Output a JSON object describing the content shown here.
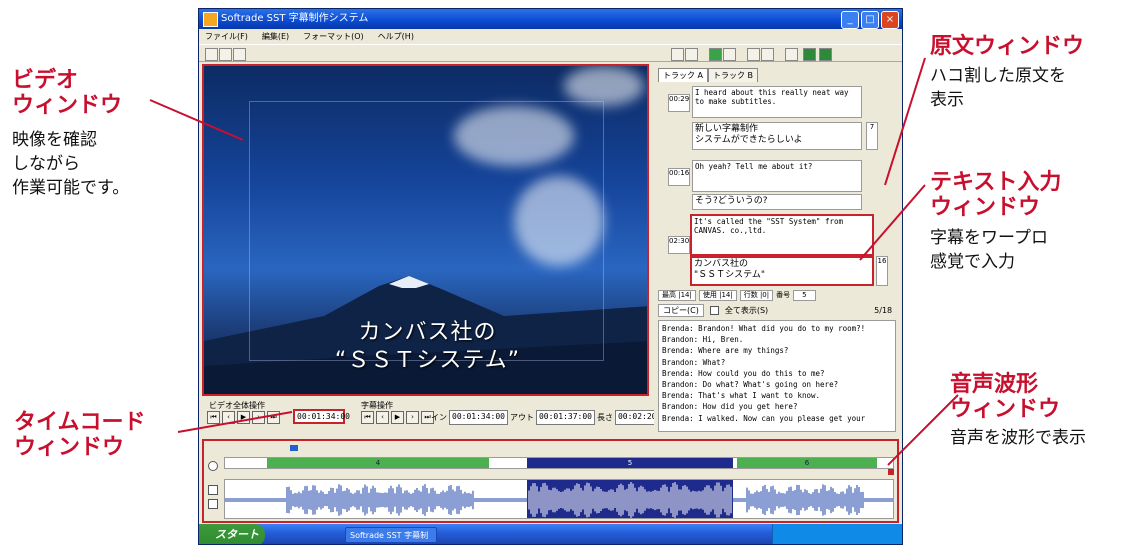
{
  "window": {
    "title": "Softrade SST 字幕制作システム",
    "menu": [
      "ファイル(F)",
      "編集(E)",
      "フォーマット(O)",
      "ヘルプ(H)"
    ],
    "min": "_",
    "max": "□",
    "close": "×"
  },
  "video": {
    "subtitle_line1": "カンバス社の",
    "subtitle_line2": "“ＳＳＴシステム”"
  },
  "video_controls": {
    "label": "ビデオ全体操作",
    "timecode": "00:01:34:00"
  },
  "subtitle_controls": {
    "label": "字幕操作",
    "in_label": "イン",
    "in_value": "00:01:34:00",
    "out_label": "アウト",
    "out_value": "00:01:37:00",
    "length_label": "長さ",
    "length_value": "00:02:20"
  },
  "tabs": [
    "トラック A",
    "トラック B"
  ],
  "entries": [
    {
      "index": "00:29",
      "source": "I heard about this really neat way to make subtitles.",
      "text": "新しい字幕制作\nシステムができたらしいよ",
      "flag": "7"
    },
    {
      "index": "00:16",
      "source": "Oh yeah? Tell me about it?",
      "text": "そう?どういうの?",
      "flag": ""
    },
    {
      "index": "02:30",
      "source": "It's called the \"SST System\" from CANVAS. co.,ltd.",
      "text": "カンバス社の\n\"ＳＳＴシステム\"",
      "flag": "16"
    }
  ],
  "stats": {
    "labels": [
      "最高 |14|",
      "使用 |14|",
      "行数 |0|",
      "番号"
    ],
    "count_value": "5"
  },
  "copy": {
    "button": "コピー(C)",
    "checkbox_label": "全て表示(S)",
    "page": "5/18"
  },
  "script_log": [
    "Brenda: Brandon! What did you do to my room?!",
    "Brandon: Hi, Bren.",
    "Brenda: Where are my things?",
    "Brandon: What?",
    "Brenda: How could you do this to me?",
    "Brandon: Do what? What's going on here?",
    "Brenda: That's what I want to know.",
    "Brandon: How did you get here?",
    "Brenda: I walked. Now can you please get your"
  ],
  "audio": {
    "segments": [
      "4",
      "5",
      "6"
    ]
  },
  "taskbar": {
    "start": "スタート",
    "item": "Softrade SST 字幕制"
  },
  "annotations": {
    "video_title": "ビデオ\nウィンドウ",
    "video_desc": "映像を確認\nしながら\n作業可能です。",
    "source_title": "原文ウィンドウ",
    "source_desc": "ハコ割した原文を\n表示",
    "text_title": "テキスト入力\nウィンドウ",
    "text_desc": "字幕をワープロ\n感覚で入力",
    "timecode_title": "タイムコード\nウィンドウ",
    "audio_title": "音声波形\nウィンドウ",
    "audio_desc": "音声を波形で表示"
  },
  "colors": {
    "accent": "#c8102e",
    "highlight_border": "#c8222a",
    "selected_segment": "#1e2a8c",
    "segment": "#4caf50"
  }
}
